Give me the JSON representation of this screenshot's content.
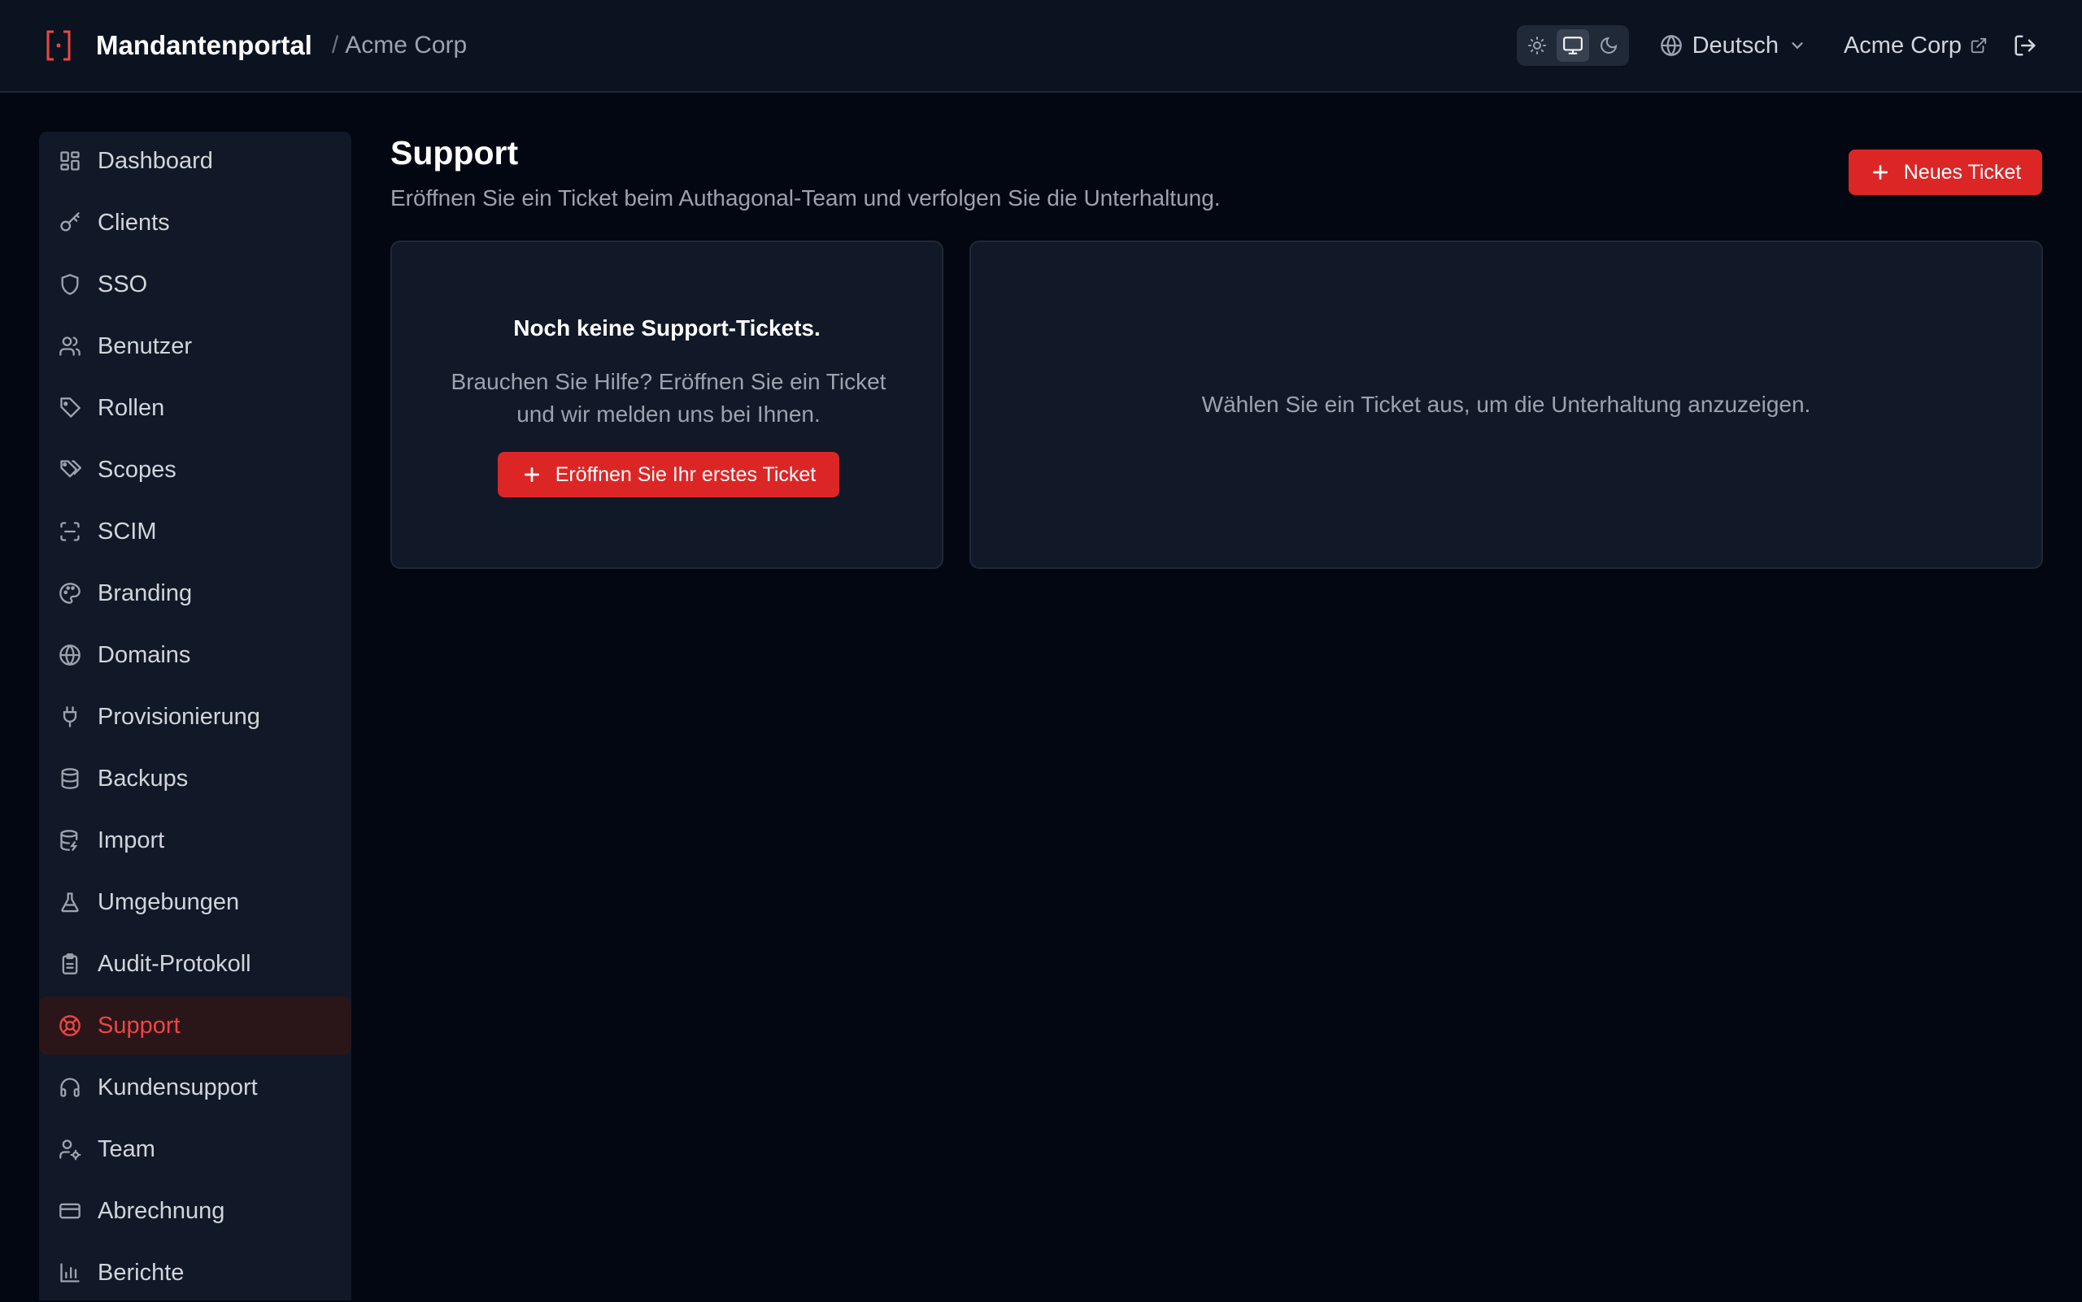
{
  "header": {
    "title": "Mandantenportal",
    "separator": "/",
    "tenant": "Acme Corp",
    "language": "Deutsch",
    "tenant_link": "Acme Corp",
    "theme_modes": [
      "light-icon",
      "monitor-icon",
      "moon-icon"
    ],
    "active_theme": "monitor-icon"
  },
  "sidebar": {
    "items": [
      {
        "label": "Dashboard",
        "icon": "dashboard-icon"
      },
      {
        "label": "Clients",
        "icon": "key-icon"
      },
      {
        "label": "SSO",
        "icon": "shield-icon"
      },
      {
        "label": "Benutzer",
        "icon": "users-icon"
      },
      {
        "label": "Rollen",
        "icon": "tag-icon"
      },
      {
        "label": "Scopes",
        "icon": "tags-icon"
      },
      {
        "label": "SCIM",
        "icon": "scan-icon"
      },
      {
        "label": "Branding",
        "icon": "palette-icon"
      },
      {
        "label": "Domains",
        "icon": "globe-icon"
      },
      {
        "label": "Provisionierung",
        "icon": "plug-icon"
      },
      {
        "label": "Backups",
        "icon": "database-icon"
      },
      {
        "label": "Import",
        "icon": "database-import-icon"
      },
      {
        "label": "Umgebungen",
        "icon": "flask-icon"
      },
      {
        "label": "Audit-Protokoll",
        "icon": "clipboard-icon"
      },
      {
        "label": "Support",
        "icon": "lifebuoy-icon",
        "active": true
      },
      {
        "label": "Kundensupport",
        "icon": "headset-icon"
      },
      {
        "label": "Team",
        "icon": "user-gear-icon"
      },
      {
        "label": "Abrechnung",
        "icon": "credit-card-icon"
      },
      {
        "label": "Berichte",
        "icon": "bar-chart-icon"
      }
    ]
  },
  "main": {
    "title": "Support",
    "subtitle": "Eröffnen Sie ein Ticket beim Authagonal-Team und verfolgen Sie die Unterhaltung.",
    "new_ticket_label": "Neues Ticket",
    "empty_title": "Noch keine Support-Tickets.",
    "empty_text": "Brauchen Sie Hilfe? Eröffnen Sie ein Ticket und wir melden uns bei Ihnen.",
    "first_ticket_label": "Eröffnen Sie Ihr erstes Ticket",
    "conversation_placeholder": "Wählen Sie ein Ticket aus, um die Unterhaltung anzuzeigen."
  },
  "colors": {
    "accent": "#dc2626",
    "background": "#030712",
    "surface": "#111827",
    "header": "#0b1220"
  }
}
